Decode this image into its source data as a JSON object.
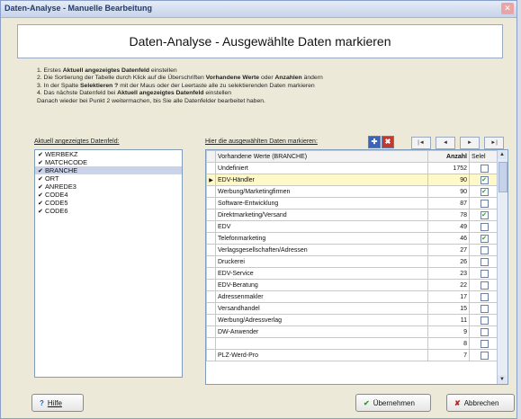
{
  "window": {
    "title": "Daten-Analyse - Manuelle Bearbeitung"
  },
  "header": {
    "title": "Daten-Analyse - Ausgewählte Daten markieren"
  },
  "instructions": [
    {
      "pre": "1. Erstes ",
      "bold": "Aktuell angezeigtes Datenfeld",
      "post": " einstellen"
    },
    {
      "pre": "2. Die Sortierung der Tabelle durch Klick auf die Überschriften ",
      "bold": "Vorhandene Werte",
      "mid": " oder ",
      "bold2": "Anzahlen",
      "post": " ändern"
    },
    {
      "pre": "3. In der Spalte ",
      "bold": "Selektieren ?",
      "post": " mit der Maus oder der Leertaste alle zu selektierenden Daten markieren"
    },
    {
      "pre": "4. Das nächste Datenfeld bei ",
      "bold": "Aktuell angezeigtes Datenfeld",
      "post": " einstellen"
    },
    {
      "pre": "Danach wieder bei Punkt 2 weitermachen, bis Sie alle Datenfelder bearbeitet haben.",
      "bold": "",
      "post": ""
    }
  ],
  "left": {
    "label": "Aktuell angezeigtes Datenfeld:",
    "items": [
      {
        "label": "WERBEKZ",
        "checked": true,
        "selected": false
      },
      {
        "label": "MATCHCODE",
        "checked": true,
        "selected": false
      },
      {
        "label": "BRANCHE",
        "checked": true,
        "selected": true
      },
      {
        "label": "ORT",
        "checked": true,
        "selected": false
      },
      {
        "label": "ANREDE3",
        "checked": true,
        "selected": false
      },
      {
        "label": "CODE4",
        "checked": true,
        "selected": false
      },
      {
        "label": "CODE5",
        "checked": true,
        "selected": false
      },
      {
        "label": "CODE6",
        "checked": true,
        "selected": false
      }
    ]
  },
  "right": {
    "label": "Hier die ausgewählten Daten markieren:",
    "columns": {
      "values": "Vorhandene Werte (BRANCHE)",
      "count": "Anzahl",
      "select": "Selel"
    },
    "rows": [
      {
        "value": "Undefiniert",
        "count": "1752",
        "checked": false,
        "current": false
      },
      {
        "value": "EDV-Händler",
        "count": "90",
        "checked": true,
        "current": true
      },
      {
        "value": "Werbung/Marketingfirmen",
        "count": "90",
        "checked": true,
        "current": false
      },
      {
        "value": "Software-Entwicklung",
        "count": "87",
        "checked": false,
        "current": false
      },
      {
        "value": "Direktmarketing/Versand",
        "count": "78",
        "checked": true,
        "current": false
      },
      {
        "value": "EDV",
        "count": "49",
        "checked": false,
        "current": false
      },
      {
        "value": "Telefonmarketing",
        "count": "46",
        "checked": true,
        "current": false
      },
      {
        "value": "Verlagsgesellschaften/Adressen",
        "count": "27",
        "checked": false,
        "current": false
      },
      {
        "value": "Druckerei",
        "count": "26",
        "checked": false,
        "current": false
      },
      {
        "value": "EDV-Service",
        "count": "23",
        "checked": false,
        "current": false
      },
      {
        "value": "EDV-Beratung",
        "count": "22",
        "checked": false,
        "current": false
      },
      {
        "value": "Adressenmakler",
        "count": "17",
        "checked": false,
        "current": false
      },
      {
        "value": "Versandhandel",
        "count": "15",
        "checked": false,
        "current": false
      },
      {
        "value": "Werbung/Adressverlag",
        "count": "11",
        "checked": false,
        "current": false
      },
      {
        "value": "DW-Anwender",
        "count": "9",
        "checked": false,
        "current": false
      },
      {
        "value": "",
        "count": "8",
        "checked": false,
        "current": false
      },
      {
        "value": "PLZ-Werd-Pro",
        "count": "7",
        "checked": false,
        "current": false
      }
    ]
  },
  "buttons": {
    "help": "Hilfe",
    "ok": "Übernehmen",
    "cancel": "Abbrechen"
  },
  "icons": {
    "help": "help-icon",
    "ok": "check-icon",
    "cancel": "x-icon"
  },
  "colors": {
    "ok_check": "#2b9b2b",
    "cancel_x": "#c0201a",
    "help": "#1f5fb8"
  }
}
